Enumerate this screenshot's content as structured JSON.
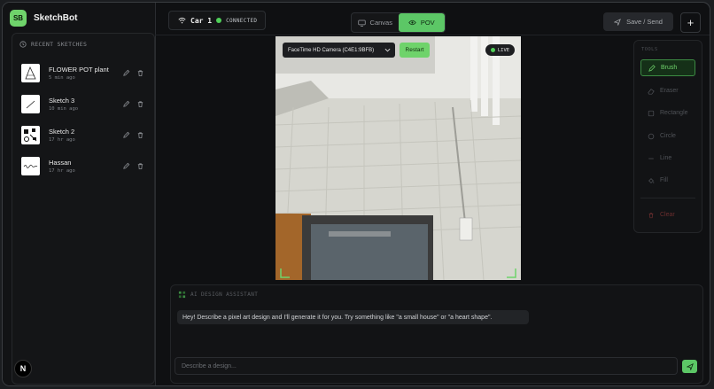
{
  "app": {
    "logo_text": "SB",
    "name": "SketchBot"
  },
  "sidebar": {
    "recent_title": "RECENT SKETCHES",
    "sketches": [
      {
        "name": "FLOWER POT plant",
        "time": "5 min ago"
      },
      {
        "name": "Sketch 3",
        "time": "10 min ago"
      },
      {
        "name": "Sketch 2",
        "time": "17 hr ago"
      },
      {
        "name": "Hassan",
        "time": "17 hr ago"
      }
    ],
    "badge": "N"
  },
  "topbar": {
    "car_name": "Car 1",
    "car_status": "CONNECTED",
    "tabs": [
      {
        "label": "Canvas"
      },
      {
        "label": "POV"
      }
    ],
    "active_tab": "POV",
    "save_label": "Save / Send",
    "add_label": "+"
  },
  "camera": {
    "device": "FaceTime HD Camera (C4E1:9BFB)",
    "restart_label": "Restart",
    "live_label": "LIVE"
  },
  "tools": {
    "title": "TOOLS",
    "items": [
      {
        "label": "Brush",
        "icon": "brush-icon"
      },
      {
        "label": "Eraser",
        "icon": "eraser-icon"
      },
      {
        "label": "Rectangle",
        "icon": "rectangle-icon"
      },
      {
        "label": "Circle",
        "icon": "circle-icon"
      },
      {
        "label": "Line",
        "icon": "line-icon"
      },
      {
        "label": "Fill",
        "icon": "fill-icon"
      }
    ],
    "clear_label": "Clear"
  },
  "assistant": {
    "title": "AI DESIGN ASSISTANT",
    "message": "Hey! Describe a pixel art design and I'll generate it for you. Try something like \"a small house\" or \"a heart shape\".",
    "input_placeholder": "Describe a design..."
  },
  "colors": {
    "accent": "#5cc766",
    "background": "#0f1012",
    "danger": "#6b2e2e"
  }
}
